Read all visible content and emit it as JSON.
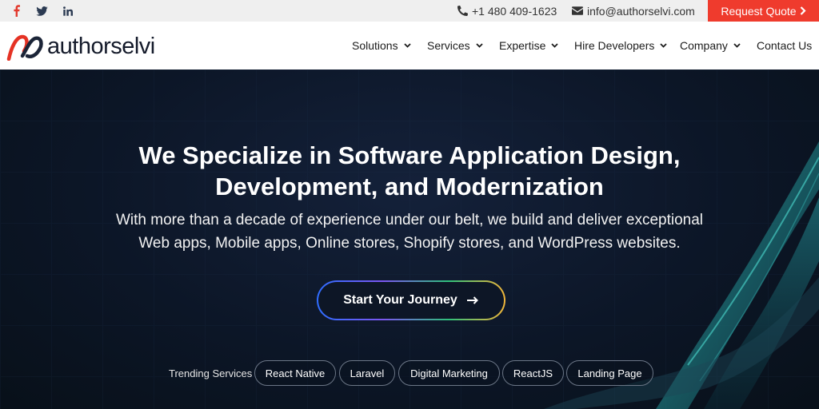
{
  "topbar": {
    "social": [
      {
        "name": "facebook",
        "icon": "facebook-icon",
        "color": "#e2392d"
      },
      {
        "name": "twitter",
        "icon": "twitter-icon",
        "color": "#2b3a52"
      },
      {
        "name": "linkedin",
        "icon": "linkedin-icon",
        "color": "#2b3a52"
      }
    ],
    "phone": "+1 480 409-1623",
    "email": "info@authorselvi.com",
    "request_quote": "Request Quote"
  },
  "header": {
    "logo_text": "authorselvi",
    "nav": [
      "Solutions",
      "Services",
      "Expertise",
      "Hire Developers",
      "Company",
      "Contact Us"
    ]
  },
  "hero": {
    "heading_line1": "We Specialize in Software Application Design,",
    "heading_line2": "Development, and Modernization",
    "sub_line1": "With more than a decade of experience under our belt, we build and deliver exceptional",
    "sub_line2": "Web apps, Mobile apps, Online stores, Shopify stores, and WordPress websites.",
    "cta_label": "Start Your Journey",
    "trending_label": "Trending Services",
    "trending": [
      "React Native",
      "Laravel",
      "Digital Marketing",
      "ReactJS",
      "Landing Page"
    ]
  },
  "colors": {
    "accent_red": "#ef3b2d",
    "hero_bg": "#0c1627",
    "nav_text": "#1c1c1c",
    "teal_swoosh": "#1f8a8c"
  }
}
